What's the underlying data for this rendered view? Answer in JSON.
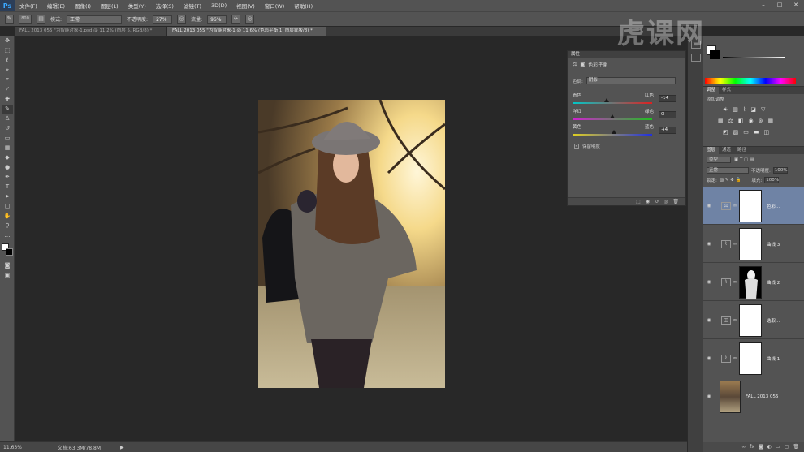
{
  "menubar": {
    "logo": "Ps",
    "items": [
      "文件(F)",
      "编辑(E)",
      "图像(I)",
      "图层(L)",
      "类型(Y)",
      "选择(S)",
      "滤镜(T)",
      "3D(D)",
      "视图(V)",
      "窗口(W)",
      "帮助(H)"
    ]
  },
  "options": {
    "brush_size": "800",
    "mode_label": "模式:",
    "mode_value": "正常",
    "opacity_label": "不透明度:",
    "opacity_value": "27%",
    "flow_label": "流量:",
    "flow_value": "96%"
  },
  "tabs": [
    {
      "label": "FALL 2013 055 \"为智能对象-1.psd @ 11.2% (图层 5, RGB/8) *",
      "active": false
    },
    {
      "label": "FALL 2013 055 \"为智能对象-1 @ 11.6% (色彩平衡 1, 图层蒙版/8) *",
      "active": true
    }
  ],
  "status": {
    "zoom": "11.63%",
    "doc": "文档:63.3M/78.8M"
  },
  "properties": {
    "header": "属性",
    "title": "色彩平衡",
    "tone_label": "色调:",
    "tone_value": "阴影",
    "sliders": [
      {
        "left": "青色",
        "right": "红色",
        "value": "-14",
        "position": -14,
        "color": "linear-gradient(90deg,#00c8c8,#e02020)"
      },
      {
        "left": "洋红",
        "right": "绿色",
        "value": "0",
        "position": 0,
        "color": "linear-gradient(90deg,#d020d0,#20c020)"
      },
      {
        "left": "黄色",
        "right": "蓝色",
        "value": "+4",
        "position": 4,
        "color": "linear-gradient(90deg,#e0d020,#2030e0)"
      }
    ],
    "preserve_label": "保留明度"
  },
  "right_panels": {
    "adjust_tabs": [
      "调整",
      "样式"
    ],
    "adjust_title": "添加调整",
    "layers_tabs": [
      "图层",
      "通道",
      "路径"
    ],
    "kind_label": "类型",
    "blend_mode": "正常",
    "opacity_label": "不透明度:",
    "opacity_value": "100%",
    "lock_label": "锁定:",
    "fill_label": "填充:",
    "fill_value": "100%",
    "layers": [
      {
        "name": "色彩...",
        "icon": "balance-icon",
        "selected": true,
        "mask": "white"
      },
      {
        "name": "曲线 3",
        "icon": "curves-icon",
        "selected": false,
        "mask": "white"
      },
      {
        "name": "曲线 2",
        "icon": "curves-icon",
        "selected": false,
        "mask": "figure"
      },
      {
        "name": "选取...",
        "icon": "selective-icon",
        "selected": false,
        "mask": "white"
      },
      {
        "name": "曲线 1",
        "icon": "curves-icon",
        "selected": false,
        "mask": "white"
      },
      {
        "name": "FALL 2013 055",
        "icon": "photo",
        "selected": false,
        "mask": "photo"
      }
    ]
  },
  "watermark": "虎课网"
}
